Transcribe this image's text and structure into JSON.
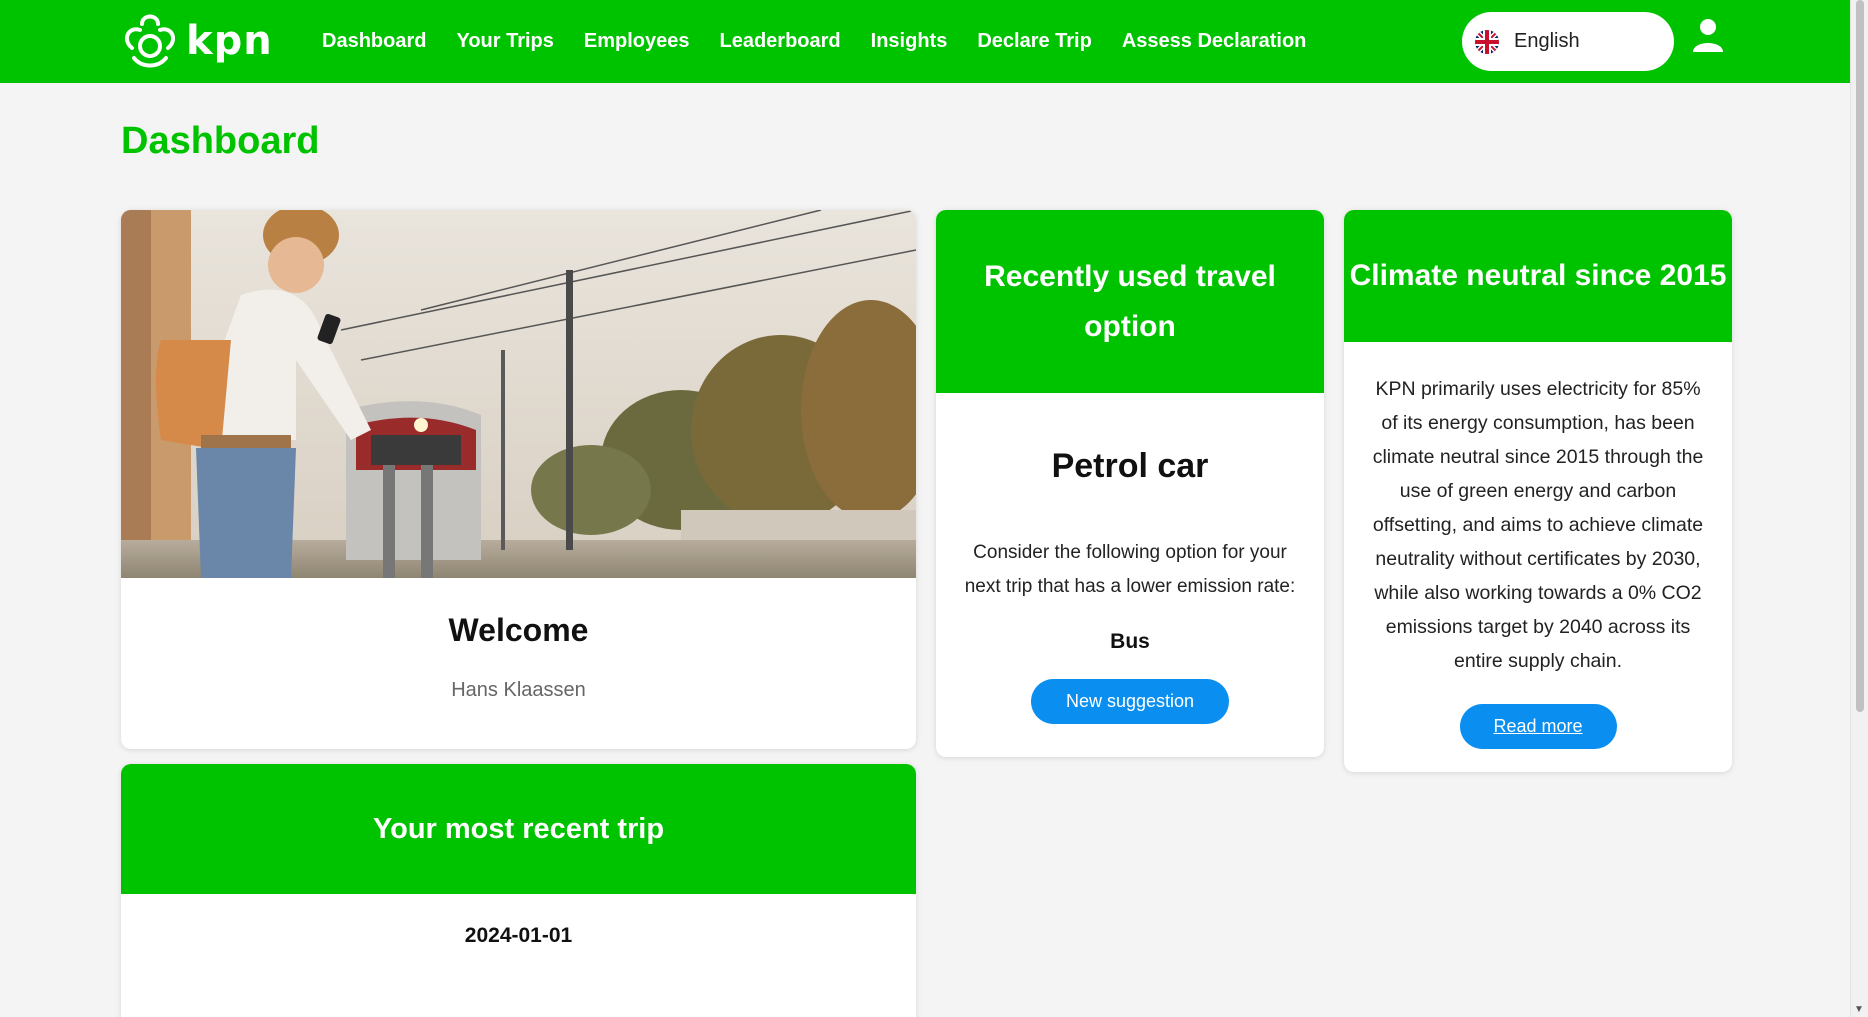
{
  "header": {
    "logo_text": "kpn",
    "nav": [
      "Dashboard",
      "Your Trips",
      "Employees",
      "Leaderboard",
      "Insights",
      "Declare Trip",
      "Assess Declaration"
    ],
    "language": "English"
  },
  "page": {
    "title": "Dashboard"
  },
  "welcome": {
    "title": "Welcome",
    "name": "Hans Klaassen"
  },
  "travel": {
    "heading": "Recently used travel option",
    "mode": "Petrol car",
    "description": "Consider the following option for your next trip that has a lower emission rate:",
    "alternative": "Bus",
    "button": "New suggestion"
  },
  "climate": {
    "heading": "Climate neutral since 2015",
    "text": "KPN primarily uses electricity for 85% of its energy consumption, has been climate neutral since 2015 through the use of green energy and carbon offsetting, and aims to achieve climate neutrality without certificates by 2030, while also working towards a 0% CO2 emissions target by 2040 across its entire supply chain.",
    "button": "Read more"
  },
  "trip": {
    "heading": "Your most recent trip",
    "date": "2024-01-01"
  },
  "colors": {
    "brand": "#00c300",
    "button": "#0a8ff0",
    "background": "#f4f4f4"
  },
  "icons": [
    "kpn-logo-icon",
    "uk-flag-icon",
    "user-icon",
    "scroll-down-icon"
  ]
}
